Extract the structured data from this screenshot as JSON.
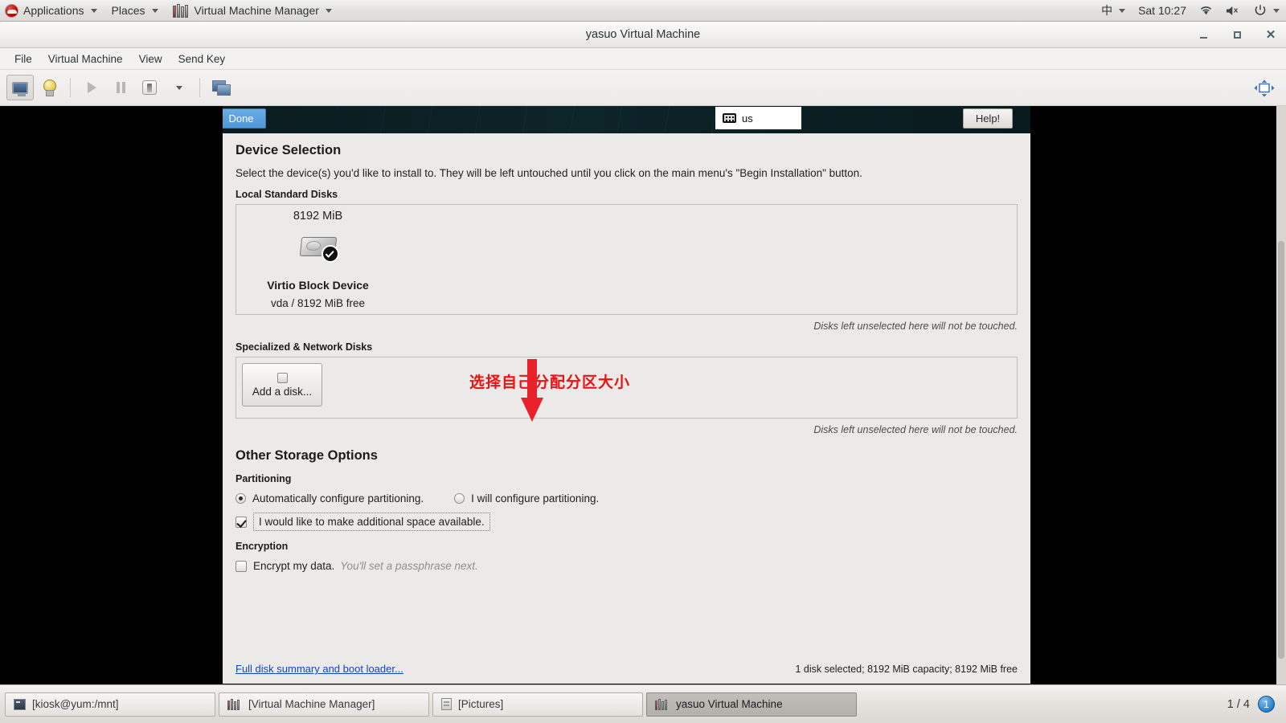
{
  "top_panel": {
    "logo_icon": "redhat-logo-icon",
    "menus": [
      {
        "label": "Applications",
        "has_arrow": true
      },
      {
        "label": "Places",
        "has_arrow": true
      },
      {
        "label": "Virtual Machine Manager",
        "has_arrow": true,
        "icon": "vmm-icon"
      }
    ],
    "right": {
      "ime": "中",
      "clock": "Sat 10:27",
      "wifi_icon": "wifi-icon",
      "volume_icon": "volume-muted-icon",
      "power_icon": "power-icon"
    }
  },
  "vm_window": {
    "title": "yasuo Virtual Machine",
    "controls": {
      "minimize": "minimize-icon",
      "maximize": "maximize-icon",
      "close": "close-icon"
    },
    "menubar": [
      "File",
      "Virtual Machine",
      "View",
      "Send Key"
    ],
    "toolbar": [
      {
        "name": "show-console",
        "icon": "monitor-icon",
        "active": true
      },
      {
        "name": "show-details",
        "icon": "lightbulb-icon",
        "active": false
      },
      {
        "name": "run",
        "icon": "play-icon",
        "active": false
      },
      {
        "name": "pause",
        "icon": "pause-icon",
        "active": false
      },
      {
        "name": "shutdown",
        "icon": "power-switch-icon",
        "active": false
      },
      {
        "name": "shutdown-options",
        "icon": "chevron-down-icon",
        "active": false
      },
      {
        "name": "snapshots",
        "icon": "clone-screens-icon",
        "active": false
      }
    ],
    "resize_icon": "fit-to-screen-icon"
  },
  "installer": {
    "header": {
      "done_label": "Done",
      "keyboard_layout": "us",
      "keyboard_icon": "keyboard-icon",
      "help_label": "Help!"
    },
    "page_title": "Device Selection",
    "page_description": "Select the device(s) you'd like to install to.  They will be left untouched until you click on the main menu's \"Begin Installation\" button.",
    "local_disks": {
      "label": "Local Standard Disks",
      "disk": {
        "capacity": "8192 MiB",
        "name": "Virtio Block Device",
        "detail": "vda / 8192 MiB free",
        "selected": true,
        "icon": "hard-disk-selected-icon"
      },
      "note": "Disks left unselected here will not be touched."
    },
    "specialized_disks": {
      "label": "Specialized & Network Disks",
      "add_disk_label": "Add a disk...",
      "add_disk_icon": "add-disk-icon",
      "note": "Disks left unselected here will not be touched."
    },
    "annotation": {
      "text": "选择自己分配分区大小",
      "color": "#ee1111",
      "arrow_icon": "red-down-arrow-icon",
      "arrow_color": "#e8212b"
    },
    "other_storage": {
      "title": "Other Storage Options",
      "partitioning": {
        "label": "Partitioning",
        "options": [
          {
            "label": "Automatically configure partitioning.",
            "selected": true
          },
          {
            "label": "I will configure partitioning.",
            "selected": false
          }
        ],
        "additional_space": {
          "label": "I would like to make additional space available.",
          "checked": true,
          "focused": true
        }
      },
      "encryption": {
        "label": "Encryption",
        "checkbox_label": "Encrypt my data.",
        "hint": "You'll set a passphrase next.",
        "checked": false
      }
    },
    "footer": {
      "summary_link": "Full disk summary and boot loader...",
      "status": "1 disk selected; 8192 MiB capacity; 8192 MiB free"
    }
  },
  "taskbar": {
    "tasks": [
      {
        "label": "[kiosk@yum:/mnt]",
        "icon": "terminal-icon",
        "active": false
      },
      {
        "label": "[Virtual Machine Manager]",
        "icon": "vmm-icon",
        "active": false
      },
      {
        "label": "[Pictures]",
        "icon": "pictures-icon",
        "active": false
      },
      {
        "label": "yasuo Virtual Machine",
        "icon": "vmm-icon",
        "active": true
      }
    ],
    "workspace": "1 / 4",
    "workspace_badge": "1"
  }
}
